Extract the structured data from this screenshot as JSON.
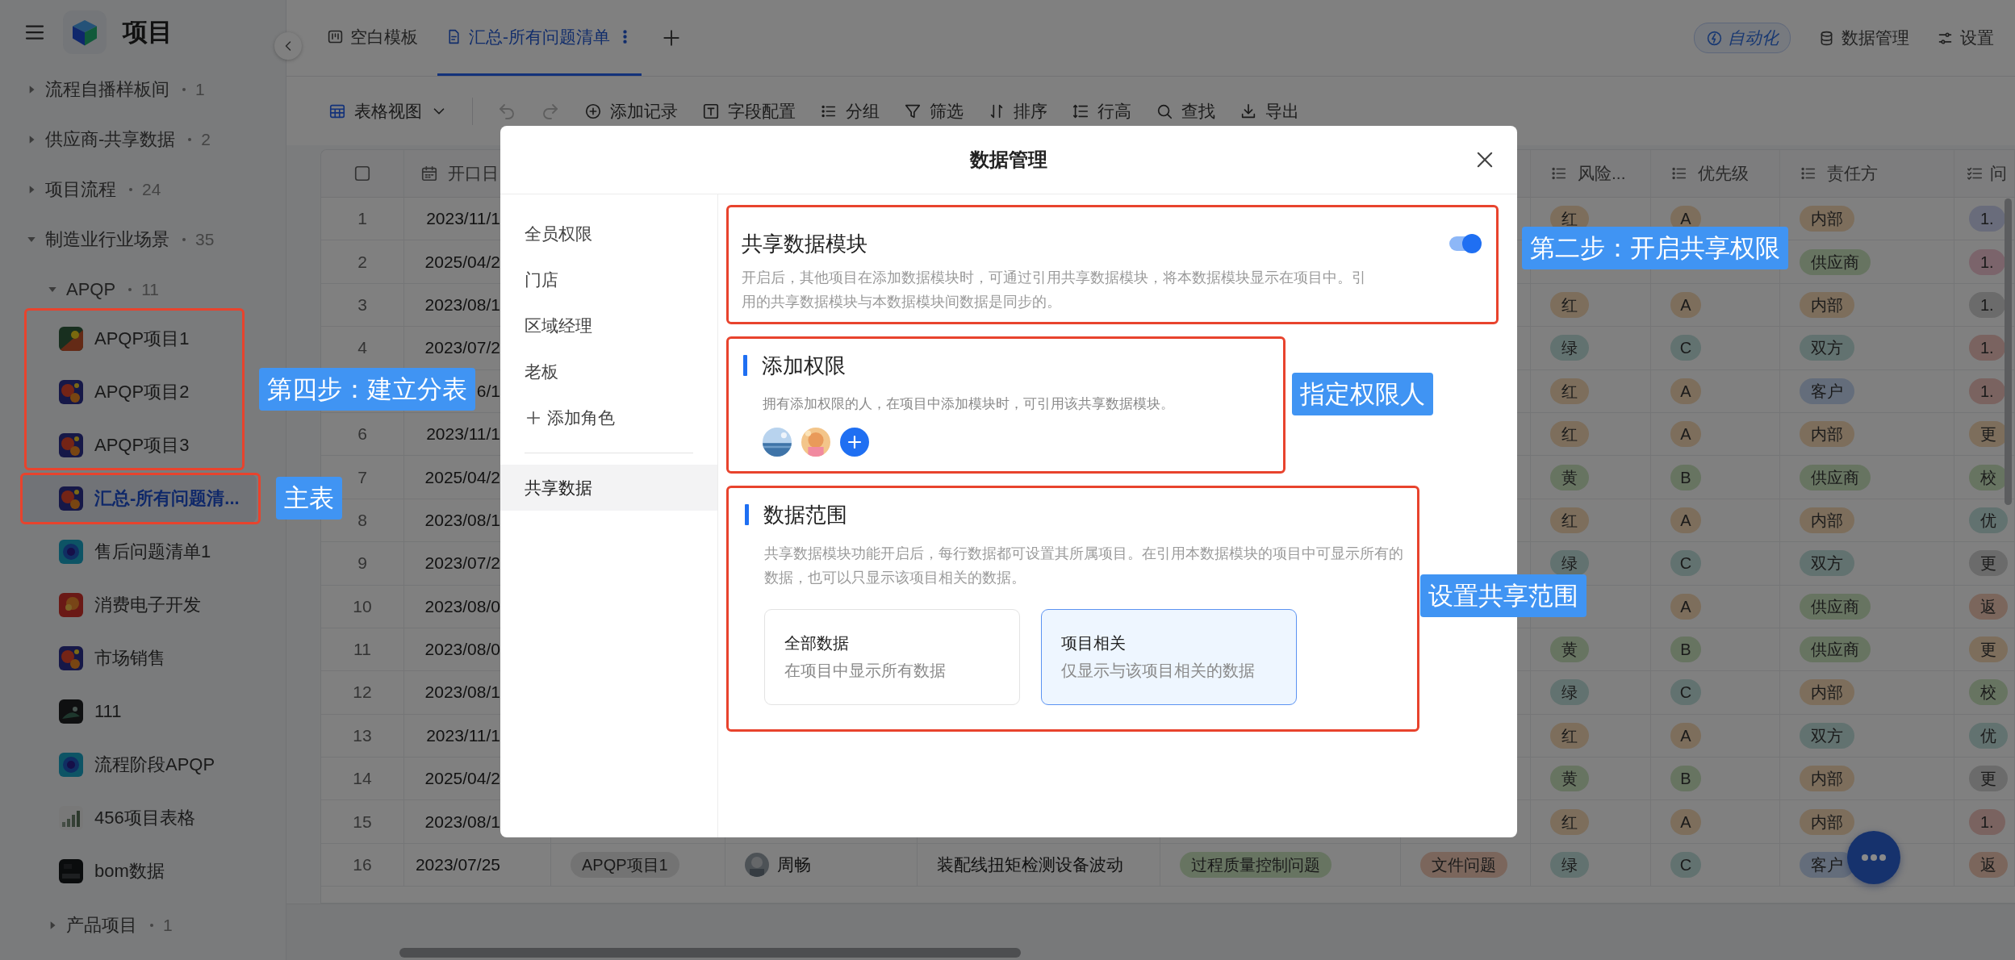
{
  "sidebar": {
    "title": "项目",
    "tree": [
      {
        "label": "流程自播样板间",
        "count": "1",
        "expanded": false
      },
      {
        "label": "供应商-共享数据",
        "count": "2",
        "expanded": false
      },
      {
        "label": "项目流程",
        "count": "24",
        "expanded": false
      },
      {
        "label": "制造业行业场景",
        "count": "35",
        "expanded": true,
        "children": [
          {
            "label": "APQP",
            "count": "11",
            "expanded": true,
            "children": [
              {
                "label": "APQP项目1",
                "selected": false
              },
              {
                "label": "APQP项目2",
                "selected": false
              },
              {
                "label": "APQP项目3",
                "selected": false
              },
              {
                "label": "汇总-所有问题清...",
                "selected": true
              },
              {
                "label": "售后问题清单1",
                "selected": false
              },
              {
                "label": "消费电子开发",
                "selected": false
              },
              {
                "label": "市场销售",
                "selected": false
              },
              {
                "label": "111",
                "selected": false
              },
              {
                "label": "流程阶段APQP",
                "selected": false
              },
              {
                "label": "456项目表格",
                "selected": false
              },
              {
                "label": "bom数据",
                "selected": false
              }
            ]
          },
          {
            "label": "产品项目",
            "count": "1",
            "expanded": false
          }
        ]
      }
    ]
  },
  "tabs": [
    {
      "label": "空白模板",
      "kind": "board",
      "selected": false
    },
    {
      "label": "汇总-所有问题清单",
      "kind": "doc",
      "selected": true
    }
  ],
  "header_actions": [
    {
      "kind": "automation",
      "label": "自动化"
    },
    {
      "kind": "data",
      "label": "数据管理"
    },
    {
      "kind": "settings",
      "label": "设置"
    }
  ],
  "toolbar": {
    "view": "表格视图",
    "actions": [
      {
        "kind": "add",
        "label": "添加记录"
      },
      {
        "kind": "fields",
        "label": "字段配置"
      },
      {
        "kind": "group",
        "label": "分组"
      },
      {
        "kind": "filter",
        "label": "筛选"
      },
      {
        "kind": "sort",
        "label": "排序"
      },
      {
        "kind": "height",
        "label": "行高"
      },
      {
        "kind": "search",
        "label": "查找"
      },
      {
        "kind": "export",
        "label": "导出"
      }
    ]
  },
  "table": {
    "select_all_checked": false,
    "columns": [
      {
        "label": "开口日",
        "kind": "date"
      },
      {
        "label": "风险...",
        "kind": "select"
      },
      {
        "label": "优先级",
        "kind": "select"
      },
      {
        "label": "责任方",
        "kind": "select"
      },
      {
        "label": "问",
        "kind": "multi"
      }
    ],
    "rows": [
      {
        "no": "1",
        "date": "2023/11/1",
        "risk": {
          "text": "红",
          "color": "#7d6e5c"
        },
        "priority": {
          "text": "A",
          "color": "#7d6e5c"
        },
        "owner": {
          "text": "内部",
          "color": "#7d6e5c"
        },
        "issue": {
          "text": "1.",
          "color": "#696c7b"
        }
      },
      {
        "no": "2",
        "date": "2025/04/2",
        "owner": {
          "text": "供应商",
          "color": "#677461"
        },
        "issue": {
          "text": "1.",
          "color": "#7b646b"
        }
      },
      {
        "no": "3",
        "date": "2023/08/1",
        "risk": {
          "text": "红",
          "color": "#7d6e5c"
        },
        "priority": {
          "text": "A",
          "color": "#7d6e5c"
        },
        "owner": {
          "text": "内部",
          "color": "#7d6e5c"
        },
        "issue": {
          "text": "1.",
          "color": "#6b6b6b"
        }
      },
      {
        "no": "4",
        "date": "2023/07/2",
        "risk": {
          "text": "绿",
          "color": "#627270"
        },
        "priority": {
          "text": "C",
          "color": "#627270"
        },
        "owner": {
          "text": "双方",
          "color": "#627270"
        },
        "issue": {
          "text": "1.",
          "color": "#7a6360"
        }
      },
      {
        "date": "6/1",
        "risk": {
          "text": "红",
          "color": "#7d6e5c"
        },
        "priority": {
          "text": "A",
          "color": "#7d6e5c"
        },
        "owner": {
          "text": "客户",
          "color": "#646d7b"
        },
        "issue": {
          "text": "1.",
          "color": "#7a6360"
        }
      },
      {
        "no": "6",
        "date": "2023/11/1",
        "risk": {
          "text": "红",
          "color": "#7d6e5c"
        },
        "priority": {
          "text": "A",
          "color": "#7d6e5c"
        },
        "owner": {
          "text": "内部",
          "color": "#7d6e5c"
        },
        "issue": {
          "text": "更",
          "color": "#7d6e5c"
        }
      },
      {
        "no": "7",
        "date": "2025/04/2",
        "risk": {
          "text": "黄",
          "color": "#677461"
        },
        "priority": {
          "text": "B",
          "color": "#677461"
        },
        "owner": {
          "text": "供应商",
          "color": "#677461"
        },
        "issue": {
          "text": "校",
          "color": "#677461"
        }
      },
      {
        "no": "8",
        "date": "2023/08/1",
        "risk": {
          "text": "红",
          "color": "#7d6e5c"
        },
        "priority": {
          "text": "A",
          "color": "#7d6e5c"
        },
        "owner": {
          "text": "内部",
          "color": "#7d6e5c"
        },
        "issue": {
          "text": "优",
          "color": "#627270"
        }
      },
      {
        "no": "9",
        "date": "2023/07/2",
        "risk": {
          "text": "绿",
          "color": "#627270"
        },
        "priority": {
          "text": "C",
          "color": "#627270"
        },
        "owner": {
          "text": "双方",
          "color": "#627270"
        },
        "issue": {
          "text": "更",
          "color": "#6b6b6b"
        }
      },
      {
        "no": "10",
        "date": "2023/08/0",
        "priority": {
          "text": "A",
          "color": "#7d6e5c"
        },
        "owner": {
          "text": "供应商",
          "color": "#677461"
        },
        "issue": {
          "text": "返",
          "color": "#7b665c"
        }
      },
      {
        "no": "11",
        "date": "2023/08/0",
        "risk": {
          "text": "黄",
          "color": "#677461"
        },
        "priority": {
          "text": "B",
          "color": "#677461"
        },
        "owner": {
          "text": "供应商",
          "color": "#677461"
        },
        "issue": {
          "text": "更",
          "color": "#7d6e5c"
        }
      },
      {
        "no": "12",
        "date": "2023/08/1",
        "risk": {
          "text": "绿",
          "color": "#627270"
        },
        "priority": {
          "text": "C",
          "color": "#627270"
        },
        "owner": {
          "text": "内部",
          "color": "#7d6e5c"
        },
        "issue": {
          "text": "校",
          "color": "#677461"
        }
      },
      {
        "no": "13",
        "date": "2023/11/1",
        "risk": {
          "text": "红",
          "color": "#7d6e5c"
        },
        "priority": {
          "text": "A",
          "color": "#7d6e5c"
        },
        "owner": {
          "text": "双方",
          "color": "#627270"
        },
        "issue": {
          "text": "优",
          "color": "#627270"
        }
      },
      {
        "no": "14",
        "date": "2025/04/2",
        "risk": {
          "text": "黄",
          "color": "#677461"
        },
        "priority": {
          "text": "B",
          "color": "#677461"
        },
        "owner": {
          "text": "内部",
          "color": "#7d6e5c"
        },
        "issue": {
          "text": "更",
          "color": "#6b6b6b"
        }
      },
      {
        "no": "15",
        "date": "2023/08/1",
        "risk": {
          "text": "红",
          "color": "#7d6e5c"
        },
        "priority": {
          "text": "A",
          "color": "#7d6e5c"
        },
        "owner": {
          "text": "内部",
          "color": "#7d6e5c"
        },
        "issue": {
          "text": "1.",
          "color": "#7a6360"
        }
      },
      {
        "no": "16",
        "date": "2023/07/25",
        "project": {
          "text": "APQP项目1",
          "color": "#737373"
        },
        "person": {
          "name": "周畅"
        },
        "description": "装配线扭矩检测设备波动",
        "type": {
          "text": "过程质量控制问题",
          "color": "#677461"
        },
        "file": {
          "text": "文件问题",
          "color": "#7b665c"
        },
        "risk": {
          "text": "绿",
          "color": "#627270"
        },
        "priority": {
          "text": "C",
          "color": "#627270"
        },
        "owner": {
          "text": "客户",
          "color": "#646d7b"
        },
        "issue": {
          "text": "返",
          "color": "#7b665c"
        }
      }
    ]
  },
  "modal": {
    "title": "数据管理",
    "nav": [
      {
        "label": "全员权限",
        "kind": "role",
        "selected": false
      },
      {
        "label": "门店",
        "kind": "role",
        "selected": false
      },
      {
        "label": "区域经理",
        "kind": "role",
        "selected": false
      },
      {
        "label": "老板",
        "kind": "role",
        "selected": false
      },
      {
        "label": "添加角色",
        "kind": "add",
        "selected": false
      },
      {
        "label": "共享数据",
        "kind": "section",
        "selected": true
      }
    ],
    "share_module": {
      "title": "共享数据模块",
      "on": true,
      "description": "开启后，其他项目在添加数据模块时，可通过引用共享数据模块，将本数据模块显示在项目中。引用的共享数据模块与本数据模块间数据是同步的。"
    },
    "add_permission": {
      "title": "添加权限",
      "description": "拥有添加权限的人，在项目中添加模块时，可引用该共享数据模块。"
    },
    "data_scope": {
      "title": "数据范围",
      "description": "共享数据模块功能开启后，每行数据都可设置其所属项目。在引用本数据模块的项目中可显示所有的数据，也可以只显示该项目相关的数据。",
      "options": [
        {
          "title": "全部数据",
          "subtitle": "在项目中显示所有数据",
          "selected": false
        },
        {
          "title": "项目相关",
          "subtitle": "仅显示与该项目相关的数据",
          "selected": true
        }
      ]
    }
  },
  "annotations": [
    {
      "text": "第二步：开启共享权限"
    },
    {
      "text": "指定权限人"
    },
    {
      "text": "设置共享范围"
    },
    {
      "text": "第四步：建立分表"
    },
    {
      "text": "主表"
    }
  ]
}
